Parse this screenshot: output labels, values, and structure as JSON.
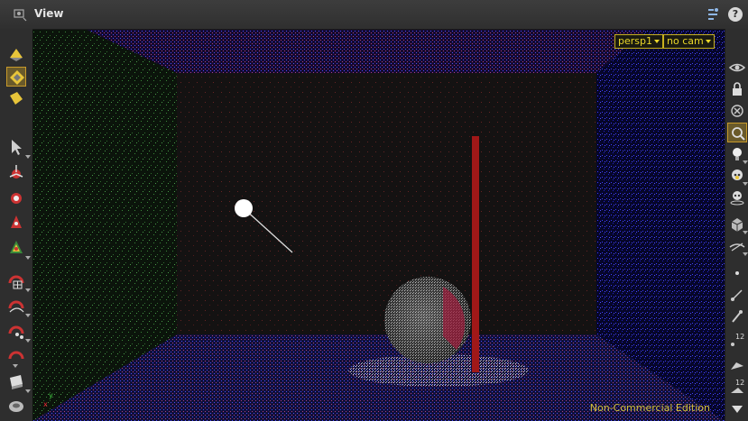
{
  "window": {
    "title": "View",
    "help_glyph": "?"
  },
  "viewport": {
    "camera_menu": "persp1",
    "camera_lock_menu": "no cam",
    "watermark": "Non-Commercial Edition",
    "axis_x_label": "x",
    "axis_y_label": "y"
  },
  "right_toolbar": {
    "label_12a": "12",
    "label_12b": "12"
  },
  "colors": {
    "accent": "#c89a2a",
    "camera_text": "#e9d62a",
    "watermark": "#d6c23a",
    "background": "#2b2b2b"
  },
  "left_toolbar_icons": [
    "paint-bucket-icon",
    "selection-orient-icon",
    "selection-tag-icon",
    "select-arrow-icon",
    "move-tool-icon",
    "rotate-tool-icon",
    "scale-tool-icon",
    "handle-tool-icon",
    "snap-grid-icon",
    "snap-curve-icon",
    "snap-points-icon",
    "snap-magnet-icon",
    "render-region-icon",
    "display-options-icon"
  ],
  "right_toolbar_icons": [
    "eye-icon",
    "lock-icon",
    "close-object-icon",
    "zoom-view-icon",
    "light-bulb-icon",
    "skull-ghost-icon",
    "skull-template-icon",
    "shading-icon",
    "visibility-icon",
    "point-display-icon",
    "normal-display-icon",
    "brush-icon",
    "point-numbers-icon",
    "prim-numbers-icon",
    "vertex-numbers-icon",
    "arrow-down-icon"
  ]
}
